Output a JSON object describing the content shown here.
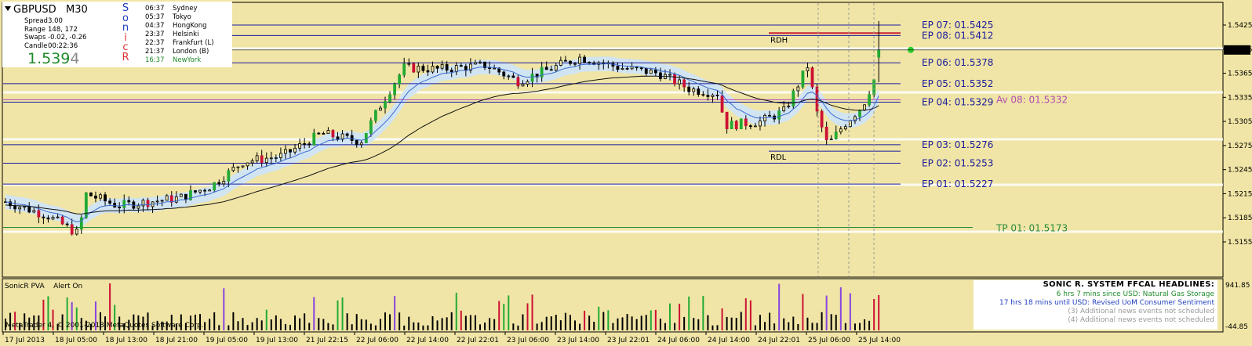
{
  "symbol": "GBPUSD",
  "timeframe": "M30",
  "info": {
    "stats": [
      {
        "k": "Spread",
        "v": "3.00"
      },
      {
        "k": "Range",
        "v": "148, 172"
      },
      {
        "k": "Swaps",
        "v": "-0.02, -0.26"
      },
      {
        "k": "Candle",
        "v": "00:22:36"
      }
    ],
    "price_main": "1.539",
    "price_digit": "4",
    "sonic_letters": [
      {
        "ch": "S",
        "color": "#1f3fbf"
      },
      {
        "ch": "o",
        "color": "#1f3fbf"
      },
      {
        "ch": "n",
        "color": "#1f3fbf"
      },
      {
        "ch": "i",
        "color": "#d33"
      },
      {
        "ch": "c",
        "color": "#d33"
      },
      {
        "ch": "R",
        "color": "#d33"
      }
    ],
    "sessions": [
      {
        "time": "06:37",
        "name": "Sydney",
        "color": "#000000"
      },
      {
        "time": "05:37",
        "name": "Tokyo",
        "color": "#000000"
      },
      {
        "time": "04:37",
        "name": "HongKong",
        "color": "#000000"
      },
      {
        "time": "23:37",
        "name": "Helsinki",
        "color": "#000000"
      },
      {
        "time": "22:37",
        "name": "Frankfurt  (L)",
        "color": "#000000"
      },
      {
        "time": "21:37",
        "name": "London  (B)",
        "color": "#000000"
      },
      {
        "time": "16:37",
        "name": "NewYork",
        "color": "#1f8a2a"
      }
    ]
  },
  "levels": [
    {
      "name": "EP 07",
      "label": "EP 07:  01.5425",
      "value": 1.5425
    },
    {
      "name": "EP 08",
      "label": "EP 08:  01.5412",
      "value": 1.5412
    },
    {
      "name": "EP 06",
      "label": "EP 06:  01.5378",
      "value": 1.5378
    },
    {
      "name": "EP 05",
      "label": "EP 05:  01.5352",
      "value": 1.5352
    },
    {
      "name": "EP 04",
      "label": "EP 04:  01.5329",
      "value": 1.5329
    },
    {
      "name": "EP 03",
      "label": "EP 03:  01.5276",
      "value": 1.5276
    },
    {
      "name": "EP 02",
      "label": "EP 02:  01.5253",
      "value": 1.5253
    },
    {
      "name": "EP 01",
      "label": "EP 01:  01.5227",
      "value": 1.5227
    }
  ],
  "tp": {
    "label": "TP 01:  01.5173",
    "value": 1.5173
  },
  "av": {
    "label": "Av 08:  01.5332",
    "value": 1.5332
  },
  "rdh": {
    "label": "RDH",
    "value": 1.5415
  },
  "rdl": {
    "label": "RDL",
    "value": 1.5268
  },
  "current_price_label": "1.5394",
  "price_axis": [
    "1.5425",
    "1.5395",
    "1.5365",
    "1.5335",
    "1.5305",
    "1.5275",
    "1.5245",
    "1.5215",
    "1.5185",
    "1.5155"
  ],
  "price_axis_values": [
    1.5425,
    1.5395,
    1.5365,
    1.5335,
    1.5305,
    1.5275,
    1.5245,
    1.5215,
    1.5185,
    1.5155
  ],
  "time_axis": [
    "17 Jul 2013",
    "18 Jul 05:00",
    "18 Jul 13:00",
    "18 Jul 21:00",
    "19 Jul 05:00",
    "19 Jul 13:00",
    "21 Jul 22:15",
    "22 Jul 06:00",
    "22 Jul 14:00",
    "22 Jul 22:01",
    "23 Jul 06:00",
    "23 Jul 14:00",
    "23 Jul 22:01",
    "24 Jul 06:00",
    "24 Jul 14:00",
    "24 Jul 22:01",
    "25 Jul 06:00",
    "25 Jul 14:00"
  ],
  "indicator": {
    "name": "SonicR PVA",
    "alert": "Alert On",
    "max_label": "941.85",
    "min_label": "-44.85"
  },
  "news": {
    "header": "SONIC R. SYSTEM  FFCAL HEADLINES:",
    "lines": [
      {
        "text": "6 hrs 7 mins since USD: Natural Gas Storage",
        "color": "#1f8a2a"
      },
      {
        "text": "17 hrs 18 mins until USD: Revised UoM Consumer Sentiment",
        "color": "#1f3fbf"
      },
      {
        "text": "(3)  Additional news events not scheduled",
        "color": "#9a9a9a"
      },
      {
        "text": "(4)  Additional news events not scheduled",
        "color": "#9a9a9a"
      }
    ]
  },
  "copyright": "MetaTrader 4, © 2001-2013 MetaQuotes Software Corp.",
  "colors": {
    "bg": "#f0e5a6",
    "ep_line": "#1a1a9c",
    "tp_line": "#2a8a3a",
    "rdh_line": "#cc2233",
    "av_line": "#b14cb5",
    "bull": "#22aa33",
    "bear": "#cc1133",
    "climax": "#8844dd",
    "dragon": "#cfe4f6"
  }
}
